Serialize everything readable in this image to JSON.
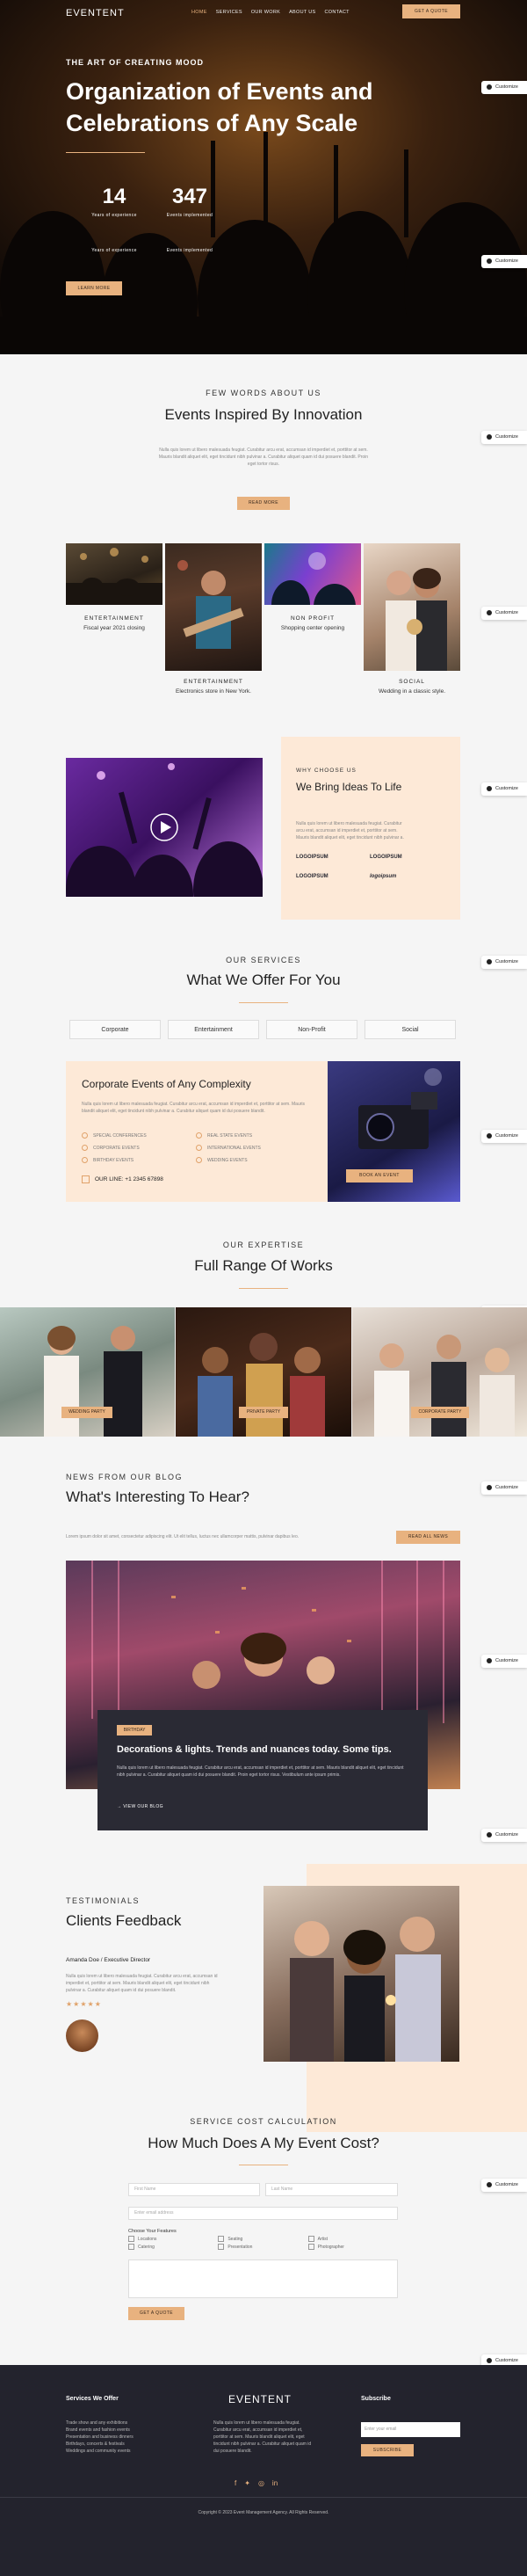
{
  "nav": {
    "logo": "EVENTENT",
    "links": [
      "HOME",
      "SERVICES",
      "OUR WORK",
      "ABOUT US",
      "CONTACT"
    ],
    "cta": "GET A QUOTE"
  },
  "hero": {
    "eyebrow": "THE ART OF CREATING MOOD",
    "title": "Organization of Events and Celebrations of Any Scale",
    "stats": [
      {
        "num": "14",
        "label": "Years of experience"
      },
      {
        "num": "347",
        "label": "Events implemented"
      }
    ],
    "stats_repeat": [
      {
        "label": "Years of experience"
      },
      {
        "label": "Events implemented"
      }
    ],
    "button": "LEARN MORE"
  },
  "customize": "Customize",
  "about": {
    "eyebrow": "FEW WORDS ABOUT US",
    "title": "Events Inspired By Innovation",
    "text": "Nulla quis lorem ut libero malesuada feugiat. Curabitur arcu erat, accumsan id imperdiet et, porttitor at sem. Mauris blandit aliquet elit, eget tincidunt nibh pulvinar a. Curabitur aliquet quam id dui posuere blandit. Proin eget tortor risus.",
    "button": "READ MORE"
  },
  "cards": [
    {
      "label": "ENTERTAINMENT",
      "caption": "Fiscal year 2021 closing"
    },
    {
      "label": "ENTERTAINMENT",
      "caption": "Electronics store in New York."
    },
    {
      "label": "NON PROFIT",
      "caption": "Shopping center opening"
    },
    {
      "label": "SOCIAL",
      "caption": "Wedding in a classic style."
    }
  ],
  "why": {
    "eyebrow": "WHY CHOOSE US",
    "title": "We Bring Ideas To Life",
    "text": "Nulla quis lorem ut libero malesuada feugiat. Curabitur arcu erat, accumsan id imperdiet et, porttitor at sem. Mauris blandit aliquet elit, eget tincidunt nibh pulvinar a.",
    "logos": [
      "LOGOIPSUM",
      "LOGOIPSUM",
      "LOGOIPSUM",
      "logoipsum"
    ]
  },
  "services": {
    "eyebrow": "OUR SERVICES",
    "title": "What We Offer For You",
    "tabs": [
      "Corporate",
      "Entertainment",
      "Non-Profit",
      "Social"
    ],
    "panel_title": "Corporate Events of Any Complexity",
    "panel_text": "Nulla quis lorem ut libero malesuada feugiat. Curabitur arcu erat, accumsan id imperdiet et, porttitor at sem. Mauris blandit aliquet elit, eget tincidunt nibh pulvinar a. Curabitur aliquet quam id dui posuere blandit.",
    "list": [
      "SPECIAL CONFERENCES",
      "REAL STATE EVENTS",
      "CORPORATE EVENTS",
      "INTERNATIONAL EVENTS",
      "BIRTHDAY EVENTS",
      "WEDDING EVENTS"
    ],
    "phone": "OUR LINE: +1 2345 67898",
    "button": "BOOK AN EVENT"
  },
  "expertise": {
    "eyebrow": "OUR EXPERTISE",
    "title": "Full Range Of Works",
    "badges": [
      "WEDDING PARTY",
      "PRIVATE PARTY",
      "CORPORATE PARTY"
    ]
  },
  "blog": {
    "eyebrow": "NEWS FROM OUR BLOG",
    "title": "What's Interesting To Hear?",
    "text": "Lorem ipsum dolor sit amet, consectetur adipiscing elit. Ut elit tellus, luctus nec ullamcorper mattis, pulvinar dapibus leo.",
    "button": "READ ALL NEWS",
    "tag": "BIRTHDAY",
    "post_title": "Decorations & lights. Trends and nuances today. Some tips.",
    "post_text": "Nulla quis lorem ut libero malesuada feugiat. Curabitur arcu erat, accumsan id imperdiet et, porttitor at sem. Mauris blandit aliquet elit, eget tincidunt nibh pulvinar a. Curabitur aliquet quam id dui posuere blandit. Proin eget tortor risus. Vestibulum ante ipsum primis.",
    "more": "VIEW OUR BLOG"
  },
  "testimonials": {
    "eyebrow": "TESTIMONIALS",
    "title": "Clients Feedback",
    "name": "Amanda Doe / Executive Director",
    "text": "Nulla quis lorem ut libero malesuada feugiat. Curabitur arcu erat, accumsan id imperdiet et, porttitor at sem. Mauris blandit aliquet elit, eget tincidunt nibh pulvinar a. Curabitur aliquet quam id dui posuere blandit.",
    "stars": "★★★★★"
  },
  "calc": {
    "eyebrow": "SERVICE COST CALCULATION",
    "title": "How Much Does A My Event Cost?",
    "first": "First Name",
    "last": "Last Name",
    "email": "Enter email address",
    "features_label": "Choose Your Features",
    "features": [
      "Locations",
      "Seating",
      "Artist",
      "Catering",
      "Presentation",
      "Photographer"
    ],
    "button": "GET A QUOTE"
  },
  "footer": {
    "col1_title": "Services We Offer",
    "col1_text": "Trade show and any exhibitions Brand events and fashion events Presentation and business dinners Birthdays, concerts & festivals Weddings and community events",
    "logo": "EVENTENT",
    "col2_text": "Nulla quis lorem ut libero malesuada feugiat. Curabitur arcu erat, accumsan id imperdiet et, porttitor at sem. Mauris blandit aliquet elit, eget tincidunt nibh pulvinar a. Curabitur aliquet quam id dui posuere blandit.",
    "col3_title": "Subscribe",
    "sub_placeholder": "Enter your email",
    "sub_button": "SUBSCRIBE",
    "copyright": "Copyright © 2023 Event Management Agency. All Rights Reserved."
  },
  "colors": {
    "accent": "#e8b27f",
    "dark": "#23232d",
    "peach": "#fde9d7"
  }
}
